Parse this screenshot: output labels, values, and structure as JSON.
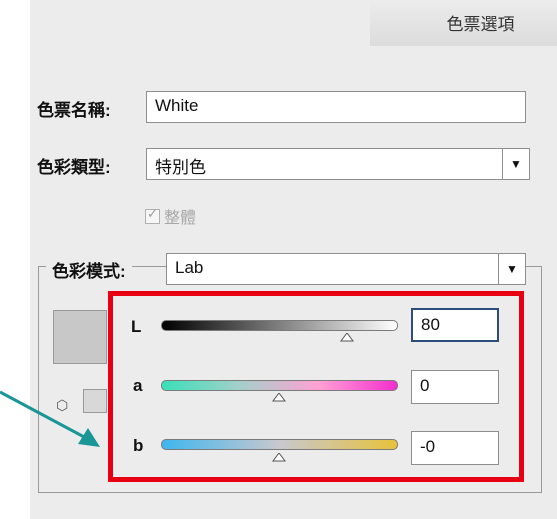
{
  "dialog": {
    "title": "色票選項",
    "swatch_name_label": "色票名稱:",
    "swatch_name_value": "White",
    "color_type_label": "色彩類型:",
    "color_type_value": "特別色",
    "global_checkbox_label": "整體",
    "color_mode_label": "色彩模式:",
    "color_mode_value": "Lab"
  },
  "channels": [
    {
      "label": "L",
      "value": "80",
      "slider_fraction": 0.79
    },
    {
      "label": "a",
      "value": "0",
      "slider_fraction": 0.5
    },
    {
      "label": "b",
      "value": "-0",
      "slider_fraction": 0.5
    }
  ],
  "colors": {
    "highlight_border": "#e60012",
    "arrow": "#1a9696",
    "swatch": "#c8c8c8"
  },
  "icons": {
    "dropdown": "chevron-down-icon",
    "spot_color": "cube-icon"
  }
}
